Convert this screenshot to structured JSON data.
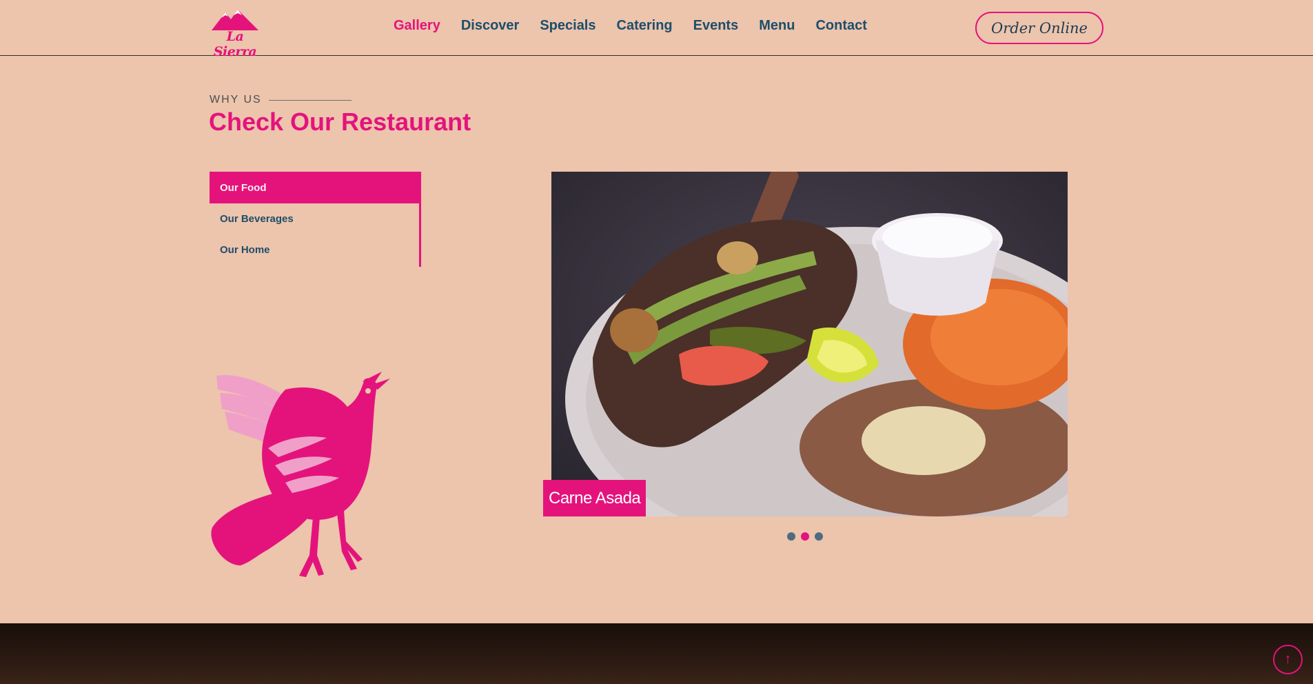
{
  "header": {
    "logo_text": "La Sierra",
    "nav": [
      {
        "label": "Gallery",
        "active": true
      },
      {
        "label": "Discover"
      },
      {
        "label": "Specials"
      },
      {
        "label": "Catering"
      },
      {
        "label": "Events"
      },
      {
        "label": "Menu"
      },
      {
        "label": "Contact"
      }
    ],
    "order_label": "Order Online"
  },
  "section": {
    "eyebrow": "WHY US",
    "title": "Check Our Restaurant"
  },
  "tabs": [
    {
      "label": "Our Food",
      "active": true
    },
    {
      "label": "Our Beverages"
    },
    {
      "label": "Our Home"
    }
  ],
  "carousel": {
    "caption": "Carne Asada",
    "dots": 3,
    "active_dot": 2
  },
  "icons": {
    "logo": "mountain-logo-icon",
    "bird": "bird-illustration-icon",
    "to_top": "arrow-up-icon"
  },
  "colors": {
    "background": "#edc4ac",
    "accent": "#e4137c",
    "nav_text": "#1c4e6b"
  }
}
